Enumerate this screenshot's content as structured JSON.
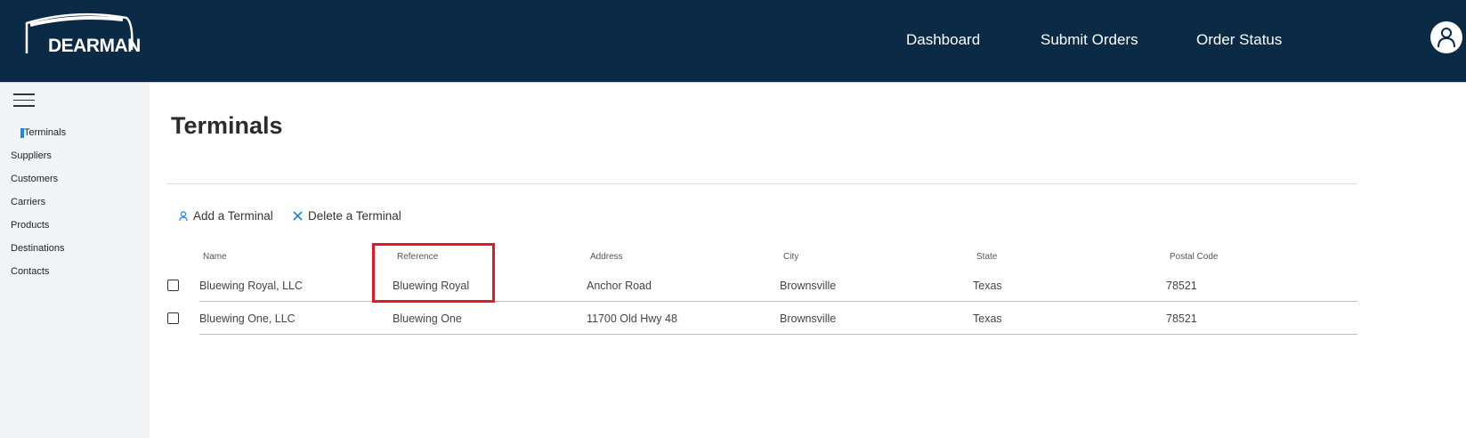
{
  "header": {
    "logo_text": "DEARMAN",
    "nav": [
      "Dashboard",
      "Submit Orders",
      "Order Status"
    ]
  },
  "sidebar": {
    "items": [
      {
        "label": "Terminals",
        "active": true
      },
      {
        "label": "Suppliers"
      },
      {
        "label": "Customers"
      },
      {
        "label": "Carriers"
      },
      {
        "label": "Products"
      },
      {
        "label": "Destinations"
      },
      {
        "label": "Contacts"
      }
    ]
  },
  "main": {
    "title": "Terminals",
    "actions": {
      "add_label": "Add a Terminal",
      "delete_label": "Delete a Terminal"
    },
    "table": {
      "headers": [
        "Name",
        "Reference",
        "Address",
        "City",
        "State",
        "Postal Code"
      ],
      "rows": [
        [
          "Bluewing Royal, LLC",
          "Bluewing Royal",
          "Anchor Road",
          "Brownsville",
          "Texas",
          "78521"
        ],
        [
          "Bluewing One, LLC",
          "Bluewing One",
          "11700 Old Hwy 48",
          "Brownsville",
          "Texas",
          "78521"
        ]
      ]
    }
  },
  "colors": {
    "header_bg": "#0b2a45",
    "sidebar_bg": "#f3f4f6",
    "accent": "#1e88e5",
    "highlight": "#e01b24"
  }
}
